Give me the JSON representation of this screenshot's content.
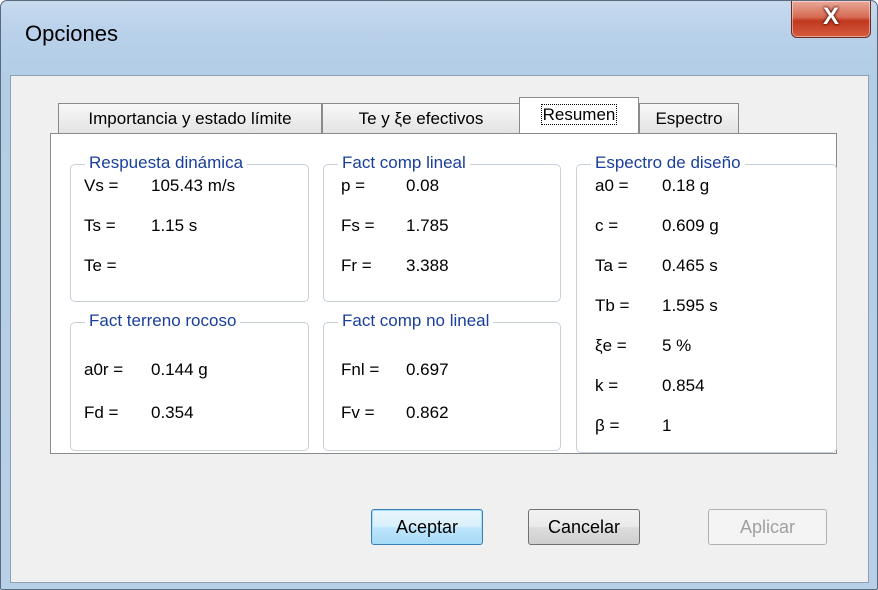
{
  "window": {
    "title": "Opciones",
    "close_glyph": "X"
  },
  "tabs": [
    {
      "label": "Importancia y estado límite",
      "active": false
    },
    {
      "label": "Te y ξe efectivos",
      "active": false
    },
    {
      "label": "Resumen",
      "active": true
    },
    {
      "label": "Espectro",
      "active": false
    }
  ],
  "groups": {
    "respuesta": {
      "legend": "Respuesta dinámica",
      "rows": [
        {
          "k": "Vs =",
          "v": "105.43 m/s"
        },
        {
          "k": "Ts =",
          "v": "1.15 s"
        },
        {
          "k": "Te =",
          "v": ""
        }
      ]
    },
    "lineal": {
      "legend": "Fact comp lineal",
      "rows": [
        {
          "k": "p =",
          "v": "0.08"
        },
        {
          "k": "Fs =",
          "v": "1.785"
        },
        {
          "k": "Fr =",
          "v": "3.388"
        }
      ]
    },
    "espectro": {
      "legend": "Espectro de diseño",
      "rows": [
        {
          "k": "a0 =",
          "v": "0.18 g"
        },
        {
          "k": "c =",
          "v": "0.609 g"
        },
        {
          "k": "Ta =",
          "v": "0.465 s"
        },
        {
          "k": "Tb =",
          "v": "1.595 s"
        },
        {
          "k": "ξe =",
          "v": "5 %"
        },
        {
          "k": "k =",
          "v": "0.854"
        },
        {
          "k": "β =",
          "v": "1"
        }
      ]
    },
    "rocoso": {
      "legend": "Fact terreno rocoso",
      "rows": [
        {
          "k": "a0r =",
          "v": "0.144 g"
        },
        {
          "k": "Fd =",
          "v": "0.354"
        }
      ]
    },
    "nolineal": {
      "legend": "Fact comp no lineal",
      "rows": [
        {
          "k": "Fnl =",
          "v": "0.697"
        },
        {
          "k": "Fv =",
          "v": "0.862"
        }
      ]
    }
  },
  "buttons": {
    "ok": "Aceptar",
    "cancel": "Cancelar",
    "apply": "Aplicar"
  }
}
